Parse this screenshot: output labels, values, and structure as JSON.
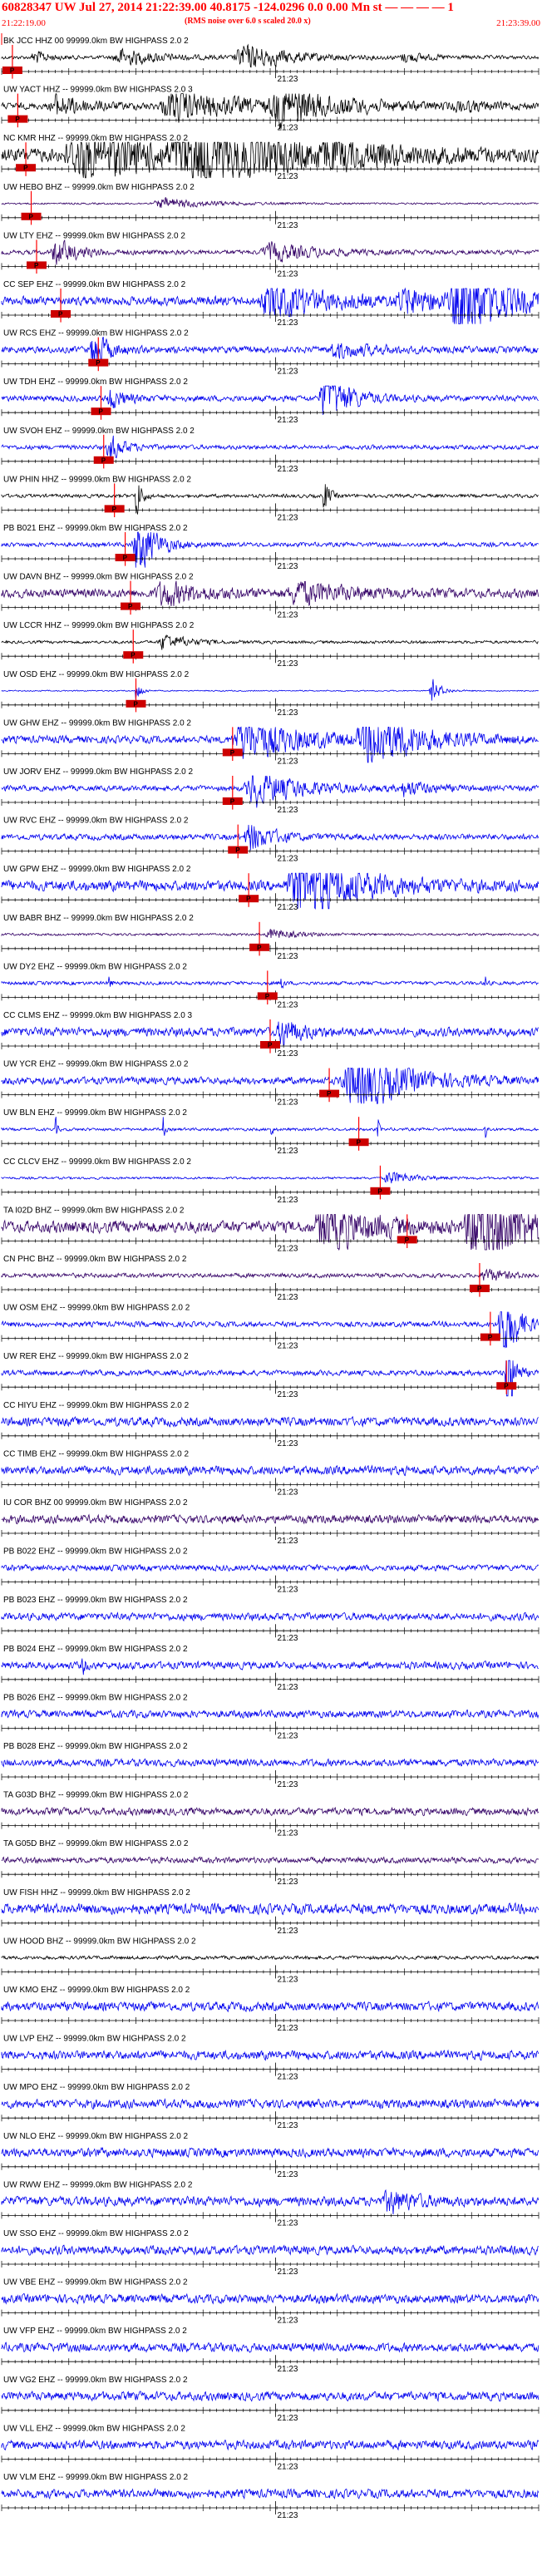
{
  "header": {
    "title": "60828347 UW Jul 27, 2014 21:22:39.00    40.8175 -124.0296  0.0 0.00 Mn st — — — — 1",
    "subtitle": "(RMS noise over 6.0 s scaled 20.0 x)",
    "start_time": "21:22:19.00",
    "end_time": "21:23:39.00"
  },
  "time_label": "21:23",
  "phase_label": "P",
  "colors": {
    "header": "#ff0000",
    "pick": "#ff0000",
    "pick_box": "#cc0000",
    "trace_blue": "#0000ee",
    "trace_black": "#000000",
    "trace_purple": "#330066",
    "axis": "#000000"
  },
  "channels": [
    {
      "label": "BK JCC HHZ 00 99999.0km BW  HIGHPASS  2.0  2",
      "color": "black",
      "pick": 0.02,
      "amp": 0.12,
      "events": [
        [
          0.06,
          0.5,
          0.03
        ],
        [
          0.22,
          0.6,
          0.08
        ],
        [
          0.45,
          0.9,
          0.1
        ],
        [
          0.75,
          0.3,
          0.05
        ]
      ]
    },
    {
      "label": "UW YACT HHZ -- 99999.0km BW  HIGHPASS  2.0  3",
      "color": "black",
      "pick": 0.03,
      "amp": 0.22,
      "events": [
        [
          0.1,
          0.8,
          0.06
        ],
        [
          0.32,
          1.0,
          0.15
        ],
        [
          0.52,
          1.2,
          0.12
        ],
        [
          0.85,
          0.3,
          0.05
        ]
      ]
    },
    {
      "label": "NC KMR HHZ -- 99999.0km BW  HIGHPASS  2.0  2",
      "color": "black",
      "pick": 0.045,
      "amp": 0.45,
      "events": [
        [
          0.15,
          1.6,
          0.2
        ],
        [
          0.35,
          1.8,
          0.2
        ],
        [
          0.6,
          0.6,
          0.1
        ]
      ]
    },
    {
      "label": "UW HEBO BHZ -- 99999.0km BW  HIGHPASS  2.0  2",
      "color": "purple",
      "pick": 0.055,
      "amp": 0.06,
      "events": [
        [
          0.3,
          0.4,
          0.1
        ]
      ]
    },
    {
      "label": "UW LTY EHZ -- 99999.0km BW  HIGHPASS  2.0  2",
      "color": "purple",
      "pick": 0.065,
      "amp": 0.15,
      "events": [
        [
          0.1,
          0.9,
          0.05
        ],
        [
          0.5,
          0.6,
          0.1
        ]
      ]
    },
    {
      "label": "CC SEP EHZ -- 99999.0km BW  HIGHPASS  2.0  2",
      "color": "blue",
      "pick": 0.11,
      "amp": 0.3,
      "events": [
        [
          0.5,
          1.2,
          0.12
        ],
        [
          0.75,
          0.8,
          0.1
        ],
        [
          0.85,
          3.5,
          0.08
        ]
      ]
    },
    {
      "label": "UW RCS EHZ -- 99999.0km BW  HIGHPASS  2.0  2",
      "color": "blue",
      "pick": 0.18,
      "amp": 0.22,
      "events": [
        [
          0.17,
          1.4,
          0.03
        ],
        [
          0.62,
          0.5,
          0.08
        ]
      ]
    },
    {
      "label": "UW TDH EHZ -- 99999.0km BW  HIGHPASS  2.0  2",
      "color": "blue",
      "pick": 0.185,
      "amp": 0.2,
      "events": [
        [
          0.2,
          0.8,
          0.03
        ],
        [
          0.6,
          2.0,
          0.05
        ]
      ]
    },
    {
      "label": "UW SVOH EHZ -- 99999.0km BW  HIGHPASS  2.0  2",
      "color": "blue",
      "pick": 0.19,
      "amp": 0.15,
      "events": [
        [
          0.2,
          1.0,
          0.03
        ]
      ]
    },
    {
      "label": "UW PHIN HHZ -- 99999.0km BW  HIGHPASS  2.0  2",
      "color": "black",
      "pick": 0.21,
      "amp": 0.12,
      "events": [
        [
          0.25,
          2.0,
          0.01
        ],
        [
          0.6,
          1.5,
          0.01
        ]
      ]
    },
    {
      "label": "PB B021 EHZ -- 99999.0km BW  HIGHPASS  2.0  2",
      "color": "blue",
      "pick": 0.23,
      "amp": 0.15,
      "events": [
        [
          0.25,
          2.2,
          0.04
        ]
      ]
    },
    {
      "label": "UW DAVN BHZ -- 99999.0km BW  HIGHPASS  2.0  2",
      "color": "purple",
      "pick": 0.24,
      "amp": 0.3,
      "events": [
        [
          0.3,
          0.8,
          0.08
        ],
        [
          0.55,
          0.8,
          0.1
        ]
      ]
    },
    {
      "label": "UW LCCR HHZ -- 99999.0km BW  HIGHPASS  2.0  2",
      "color": "black",
      "pick": 0.245,
      "amp": 0.1,
      "events": [
        [
          0.3,
          0.6,
          0.05
        ]
      ]
    },
    {
      "label": "UW OSD EHZ -- 99999.0km BW  HIGHPASS  2.0  2",
      "color": "blue",
      "pick": 0.25,
      "amp": 0.04,
      "events": [
        [
          0.25,
          1.0,
          0.01
        ],
        [
          0.8,
          0.9,
          0.02
        ]
      ]
    },
    {
      "label": "UW GHW EHZ -- 99999.0km BW  HIGHPASS  2.0  2",
      "color": "blue",
      "pick": 0.43,
      "amp": 0.25,
      "events": [
        [
          0.45,
          1.5,
          0.12
        ],
        [
          0.68,
          2.0,
          0.1
        ]
      ]
    },
    {
      "label": "UW JORV EHZ -- 99999.0km BW  HIGHPASS  2.0  2",
      "color": "blue",
      "pick": 0.43,
      "amp": 0.18,
      "events": [
        [
          0.47,
          1.2,
          0.1
        ],
        [
          0.75,
          0.5,
          0.05
        ]
      ]
    },
    {
      "label": "UW RVC EHZ -- 99999.0km BW  HIGHPASS  2.0  2",
      "color": "blue",
      "pick": 0.44,
      "amp": 0.2,
      "events": [
        [
          0.46,
          1.0,
          0.05
        ]
      ]
    },
    {
      "label": "UW GPW EHZ -- 99999.0km BW  HIGHPASS  2.0  2",
      "color": "blue",
      "pick": 0.46,
      "amp": 0.35,
      "events": [
        [
          0.55,
          2.5,
          0.12
        ]
      ]
    },
    {
      "label": "UW BABR BHZ -- 99999.0km BW  HIGHPASS  2.0  2",
      "color": "purple",
      "pick": 0.48,
      "amp": 0.08,
      "events": [
        [
          0.5,
          0.4,
          0.05
        ]
      ]
    },
    {
      "label": "UW DY2 EHZ -- 99999.0km BW  HIGHPASS  2.0  2",
      "color": "blue",
      "pick": 0.495,
      "amp": 0.12,
      "events": [
        [
          0.2,
          1.2,
          0.003
        ],
        [
          0.52,
          1.5,
          0.003
        ],
        [
          0.9,
          1.0,
          0.003
        ]
      ]
    },
    {
      "label": "CC CLMS EHZ -- 99999.0km BW  HIGHPASS  2.0  3",
      "color": "blue",
      "pick": 0.5,
      "amp": 0.3,
      "events": [
        [
          0.52,
          1.0,
          0.04
        ]
      ]
    },
    {
      "label": "UW YCR EHZ -- 99999.0km BW  HIGHPASS  2.0  2",
      "color": "blue",
      "pick": 0.61,
      "amp": 0.25,
      "events": [
        [
          0.65,
          2.5,
          0.1
        ]
      ]
    },
    {
      "label": "UW BLN EHZ -- 99999.0km BW  HIGHPASS  2.0  2",
      "color": "blue",
      "pick": 0.665,
      "amp": 0.1,
      "events": [
        [
          0.1,
          1.3,
          0.003
        ],
        [
          0.3,
          1.3,
          0.003
        ],
        [
          0.5,
          1.3,
          0.003
        ],
        [
          0.7,
          1.3,
          0.003
        ],
        [
          0.9,
          1.3,
          0.003
        ]
      ]
    },
    {
      "label": "CC CLCV EHZ -- 99999.0km BW  HIGHPASS  2.0  2",
      "color": "blue",
      "pick": 0.705,
      "amp": 0.08,
      "events": [
        [
          0.72,
          0.5,
          0.05
        ]
      ]
    },
    {
      "label": "TA I02D BHZ -- 99999.0km BW  HIGHPASS  2.0  2",
      "color": "purple",
      "pick": 0.755,
      "amp": 0.4,
      "events": [
        [
          0.6,
          1.6,
          0.1
        ],
        [
          0.88,
          3.5,
          0.1
        ]
      ]
    },
    {
      "label": "CN PHC BHZ -- 99999.0km BW  HIGHPASS  2.0  2",
      "color": "purple",
      "pick": 0.89,
      "amp": 0.15,
      "events": [
        [
          0.9,
          0.5,
          0.04
        ]
      ]
    },
    {
      "label": "UW OSM EHZ -- 99999.0km BW  HIGHPASS  2.0  2",
      "color": "blue",
      "pick": 0.91,
      "amp": 0.18,
      "events": [
        [
          0.93,
          3.5,
          0.03
        ]
      ]
    },
    {
      "label": "UW RER EHZ -- 99999.0km BW  HIGHPASS  2.0  2",
      "color": "blue",
      "pick": 0.94,
      "amp": 0.18,
      "events": [
        [
          0.94,
          5.0,
          0.012
        ]
      ]
    },
    {
      "label": "CC HIYU EHZ -- 99999.0km BW  HIGHPASS  2.0  2",
      "color": "blue",
      "pick": null,
      "amp": 0.3,
      "events": []
    },
    {
      "label": "CC TIMB EHZ -- 99999.0km BW  HIGHPASS  2.0  2",
      "color": "blue",
      "pick": null,
      "amp": 0.3,
      "events": []
    },
    {
      "label": "IU COR BHZ 00 99999.0km BW  HIGHPASS  2.0  2",
      "color": "purple",
      "pick": null,
      "amp": 0.28,
      "events": []
    },
    {
      "label": "PB B022 EHZ -- 99999.0km BW  HIGHPASS  2.0  2",
      "color": "blue",
      "pick": null,
      "amp": 0.2,
      "events": []
    },
    {
      "label": "PB B023 EHZ -- 99999.0km BW  HIGHPASS  2.0  2",
      "color": "blue",
      "pick": null,
      "amp": 0.25,
      "events": []
    },
    {
      "label": "PB B024 EHZ -- 99999.0km BW  HIGHPASS  2.0  2",
      "color": "blue",
      "pick": null,
      "amp": 0.25,
      "events": [
        [
          0.15,
          0.8,
          0.005
        ]
      ]
    },
    {
      "label": "PB B026 EHZ -- 99999.0km BW  HIGHPASS  2.0  2",
      "color": "blue",
      "pick": null,
      "amp": 0.25,
      "events": []
    },
    {
      "label": "PB B028 EHZ -- 99999.0km BW  HIGHPASS  2.0  2",
      "color": "blue",
      "pick": null,
      "amp": 0.25,
      "events": []
    },
    {
      "label": "TA G03D BHZ -- 99999.0km BW  HIGHPASS  2.0  2",
      "color": "purple",
      "pick": null,
      "amp": 0.25,
      "events": []
    },
    {
      "label": "TA G05D BHZ -- 99999.0km BW  HIGHPASS  2.0  2",
      "color": "purple",
      "pick": null,
      "amp": 0.2,
      "events": []
    },
    {
      "label": "UW FISH HHZ -- 99999.0km BW  HIGHPASS  2.0  2",
      "color": "blue",
      "pick": null,
      "amp": 0.35,
      "events": []
    },
    {
      "label": "UW HOOD BHZ -- 99999.0km BW  HIGHPASS  2.0  2",
      "color": "black",
      "pick": null,
      "amp": 0.12,
      "events": []
    },
    {
      "label": "UW KMO EHZ -- 99999.0km BW  HIGHPASS  2.0  2",
      "color": "blue",
      "pick": null,
      "amp": 0.3,
      "events": []
    },
    {
      "label": "UW LVP EHZ -- 99999.0km BW  HIGHPASS  2.0  2",
      "color": "blue",
      "pick": null,
      "amp": 0.3,
      "events": []
    },
    {
      "label": "UW MPO EHZ -- 99999.0km BW  HIGHPASS  2.0  2",
      "color": "blue",
      "pick": null,
      "amp": 0.3,
      "events": []
    },
    {
      "label": "UW NLO EHZ -- 99999.0km BW  HIGHPASS  2.0  2",
      "color": "blue",
      "pick": null,
      "amp": 0.3,
      "events": []
    },
    {
      "label": "UW RWW EHZ -- 99999.0km BW  HIGHPASS  2.0  2",
      "color": "blue",
      "pick": null,
      "amp": 0.32,
      "events": [
        [
          0.72,
          0.8,
          0.05
        ]
      ]
    },
    {
      "label": "UW SSO EHZ -- 99999.0km BW  HIGHPASS  2.0  2",
      "color": "blue",
      "pick": null,
      "amp": 0.3,
      "events": []
    },
    {
      "label": "UW VBE EHZ -- 99999.0km BW  HIGHPASS  2.0  2",
      "color": "blue",
      "pick": null,
      "amp": 0.3,
      "events": []
    },
    {
      "label": "UW VFP EHZ -- 99999.0km BW  HIGHPASS  2.0  2",
      "color": "blue",
      "pick": null,
      "amp": 0.3,
      "events": []
    },
    {
      "label": "UW VG2 EHZ -- 99999.0km BW  HIGHPASS  2.0  2",
      "color": "blue",
      "pick": null,
      "amp": 0.3,
      "events": []
    },
    {
      "label": "UW VLL EHZ -- 99999.0km BW  HIGHPASS  2.0  2",
      "color": "blue",
      "pick": null,
      "amp": 0.3,
      "events": []
    },
    {
      "label": "UW VLM EHZ -- 99999.0km BW  HIGHPASS  2.0  2",
      "color": "blue",
      "pick": null,
      "amp": 0.3,
      "events": []
    }
  ]
}
